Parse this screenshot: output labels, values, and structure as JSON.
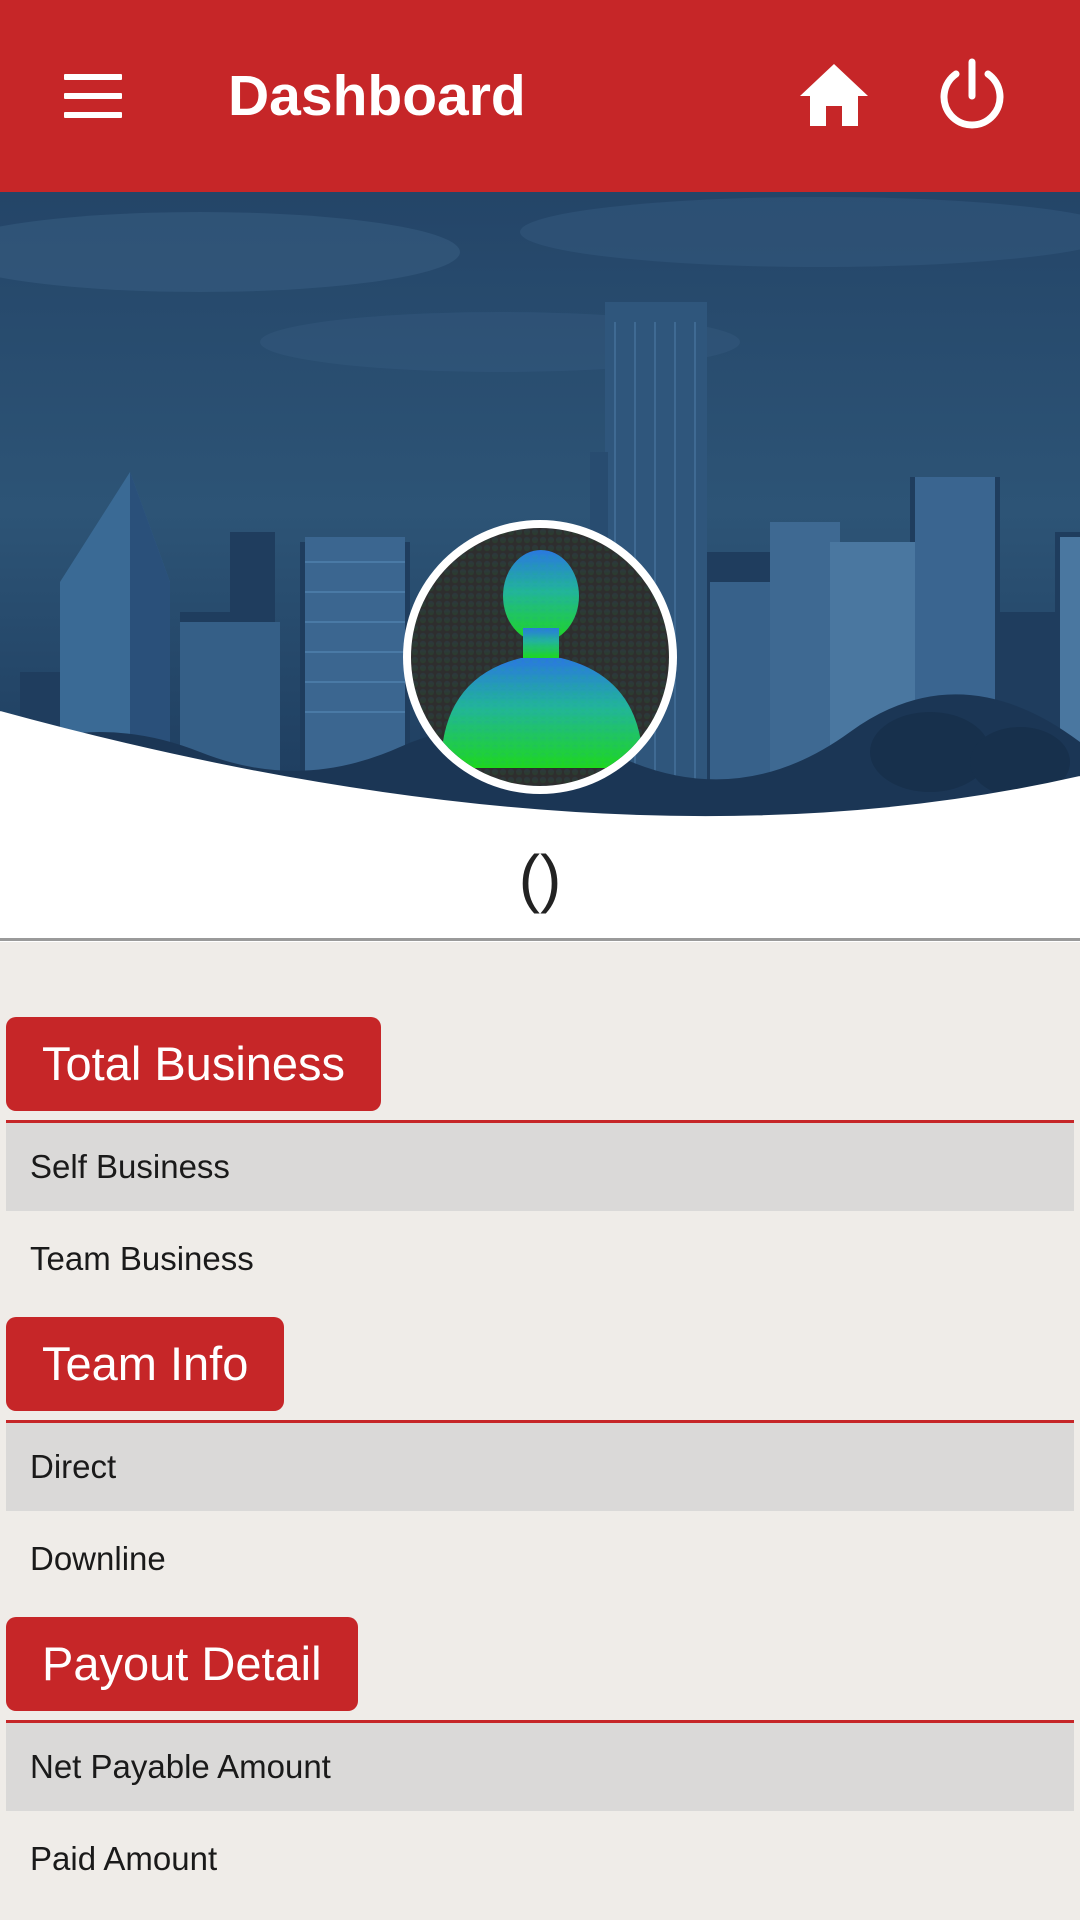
{
  "header": {
    "title": "Dashboard",
    "menu_icon": "hamburger-menu-icon",
    "home_icon": "home-icon",
    "power_icon": "power-icon",
    "accent_color": "#c62628"
  },
  "profile": {
    "username": "()"
  },
  "sections": [
    {
      "title": "Total Business",
      "rows": [
        "Self Business",
        "Team Business"
      ]
    },
    {
      "title": "Team Info",
      "rows": [
        "Direct",
        "Downline"
      ]
    },
    {
      "title": "Payout Detail",
      "rows": [
        "Net Payable Amount",
        "Paid Amount"
      ]
    }
  ]
}
